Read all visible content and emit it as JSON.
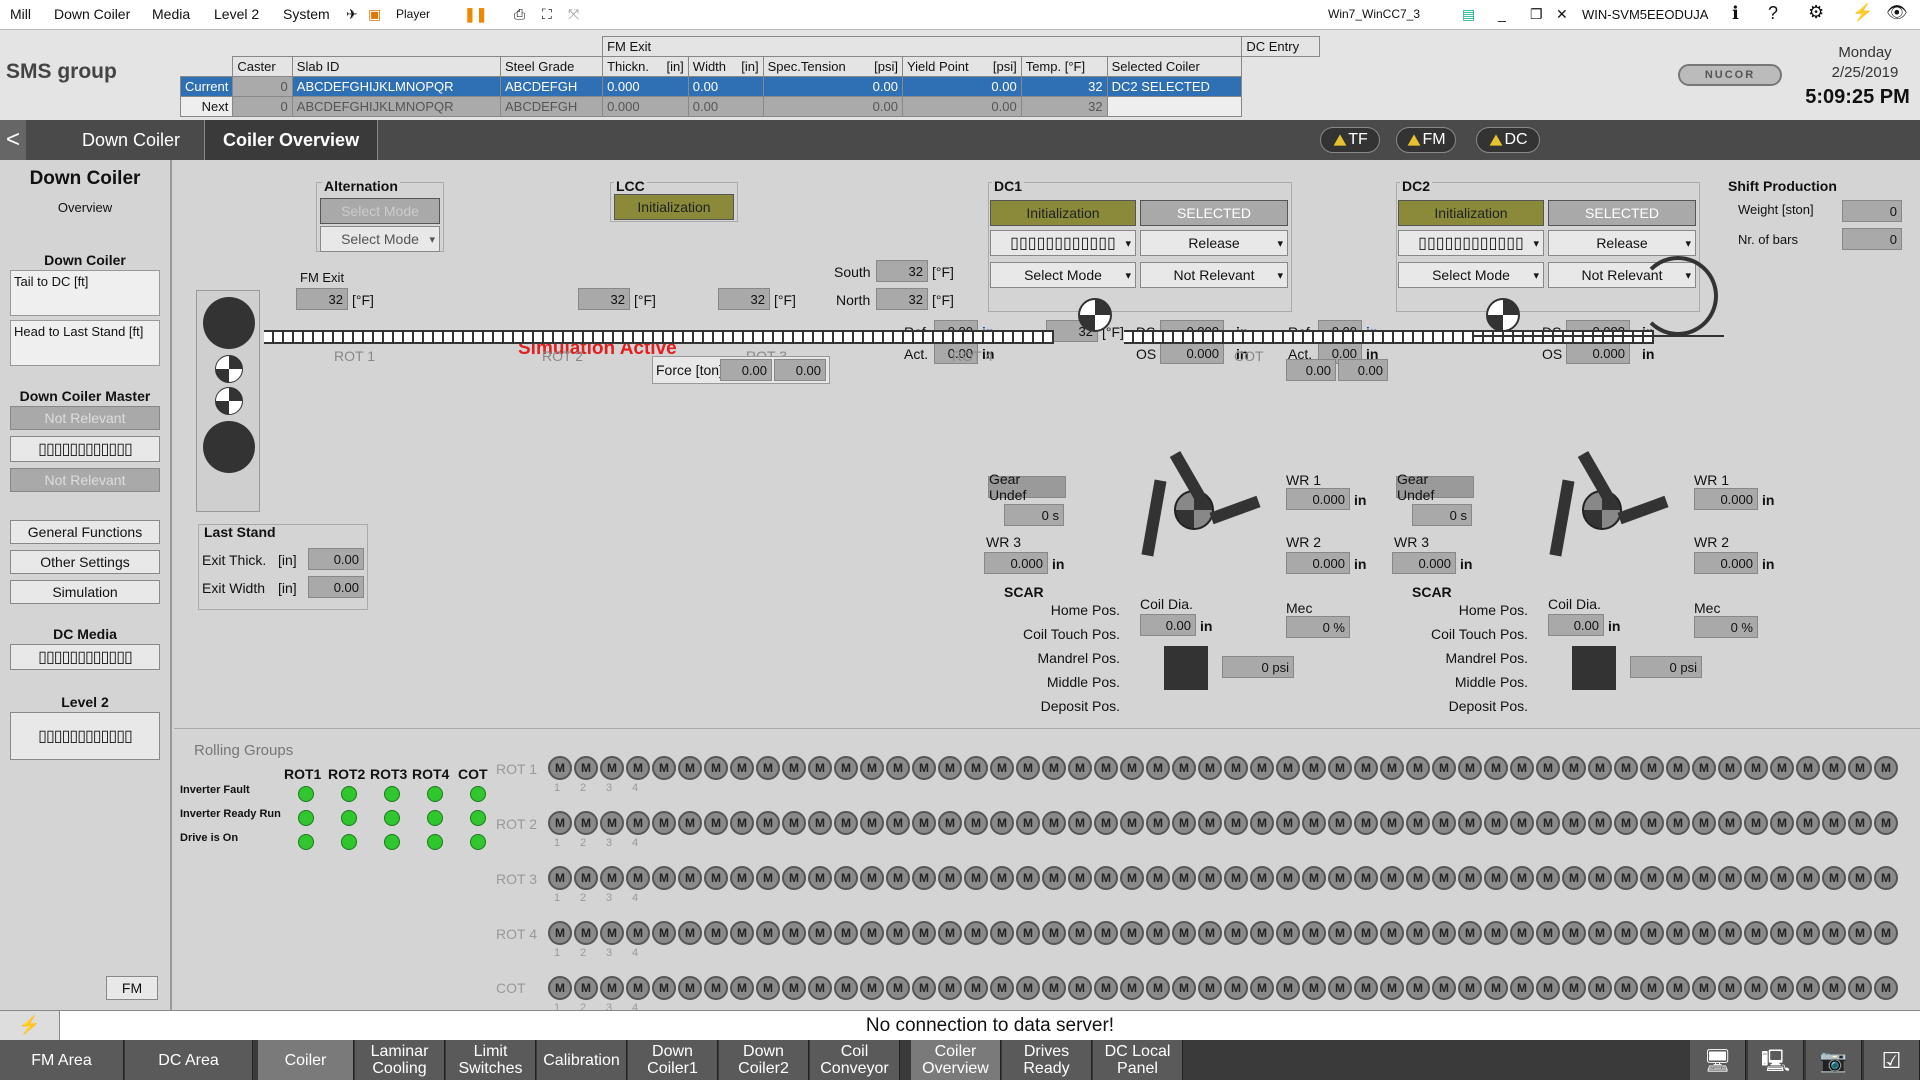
{
  "menubar": {
    "items": [
      "Mill",
      "Down Coiler",
      "Media",
      "Level 2",
      "System"
    ],
    "player": "Player",
    "host": "Win7_WinCC7_3",
    "machine": "WIN-SVM5EEODUJA"
  },
  "header": {
    "logo": "SMS group",
    "group_fm_exit": "FM Exit",
    "group_dc_entry": "DC Entry",
    "columns": [
      "Caster",
      "Slab ID",
      "Steel Grade",
      "Thickn.",
      "[in]",
      "Width",
      "[in]",
      "Spec.Tension",
      "[psi]",
      "Yield Point",
      "[psi]",
      "Temp. [°F]",
      "Selected Coiler"
    ],
    "rows": [
      {
        "label": "Current",
        "caster": "0",
        "slab": "ABCDEFGHIJKLMNOPQR",
        "grade": "ABCDEFGH",
        "thick": "0.000",
        "width": "0.00",
        "tension": "0.00",
        "yield": "0.00",
        "temp": "32",
        "coiler": "DC2 SELECTED"
      },
      {
        "label": "Next",
        "caster": "0",
        "slab": "ABCDEFGHIJKLMNOPQR",
        "grade": "ABCDEFGH",
        "thick": "0.000",
        "width": "0.00",
        "tension": "0.00",
        "yield": "0.00",
        "temp": "32",
        "coiler": ""
      }
    ],
    "brand": "NUCOR",
    "day": "Monday",
    "date": "2/25/2019",
    "time": "5:09:25 PM"
  },
  "nav": {
    "back": "<",
    "crumb1": "Down Coiler",
    "crumb2": "Coiler Overview",
    "pills": [
      "TF",
      "FM",
      "DC"
    ]
  },
  "sidebar": {
    "title": "Down Coiler",
    "subtitle": "Overview",
    "dc_title": "Down Coiler",
    "tail": "Tail to DC  [ft]",
    "head": "Head to Last Stand  [ft]",
    "master": "Down Coiler Master",
    "not_relevant": "Not Relevant",
    "general": "General Functions",
    "other": "Other Settings",
    "simulation": "Simulation",
    "media": "DC Media",
    "level2": "Level 2",
    "fm": "FM",
    "dropdown_placeholder": "▯▯▯▯▯▯▯▯▯▯▯▯"
  },
  "main": {
    "alternation": "Alternation",
    "select_mode": "Select Mode",
    "lcc": "LCC",
    "initialization": "Initialization",
    "dc1": "DC1",
    "dc2": "DC2",
    "selected": "SELECTED",
    "release": "Release",
    "not_relevant": "Not Relevant",
    "shift": "Shift Production",
    "weight": "Weight [ston]",
    "weight_val": "0",
    "bars": "Nr. of bars",
    "bars_val": "0",
    "fm_exit": "FM Exit",
    "temp": "32",
    "unit_f": "[°F]",
    "south": "South",
    "north": "North",
    "sim_active": "Simulation Active",
    "ref": "Ref.",
    "act": "Act.",
    "ds": "DS",
    "os": "OS",
    "in": "in",
    "val_000": "0.00",
    "val_0000": "0.000",
    "force": "Force [ton]",
    "rot": [
      "ROT 1",
      "ROT 2",
      "ROT 3",
      "ROT 4",
      "COT"
    ],
    "gear": "Gear Undef",
    "sec": "0 s",
    "wr1": "WR 1",
    "wr2": "WR 2",
    "wr3": "WR 3",
    "mec": "Mec",
    "pct": "0 %",
    "coil_dia": "Coil Dia.",
    "psi": "0 psi",
    "scar": "SCAR",
    "scar_items": [
      "Home Pos.",
      "Coil Touch Pos.",
      "Mandrel Pos.",
      "Middle Pos.",
      "Deposit Pos."
    ],
    "last_stand": "Last Stand",
    "exit_thick": "Exit Thick.",
    "exit_width": "Exit Width",
    "inunit": "[in]"
  },
  "rolling": {
    "title": "Rolling Groups",
    "cols": [
      "ROT1",
      "ROT2",
      "ROT3",
      "ROT4",
      "COT"
    ],
    "rows": [
      "Inverter Fault",
      "Inverter Ready Run",
      "Drive is On"
    ],
    "groups": [
      "ROT 1",
      "ROT 2",
      "ROT 3",
      "ROT 4",
      "COT"
    ],
    "motor": "M",
    "nums": [
      "1",
      "2",
      "3",
      "4"
    ]
  },
  "status": {
    "message": "No connection to data server!"
  },
  "bottom": {
    "buttons": [
      "FM Area",
      "DC Area",
      "Coiler",
      "Laminar Cooling",
      "Limit Switches",
      "Calibration",
      "Down Coiler1",
      "Down Coiler2",
      "Coil Conveyor",
      "Coiler Overview",
      "Drives Ready",
      "DC Local Panel"
    ]
  }
}
